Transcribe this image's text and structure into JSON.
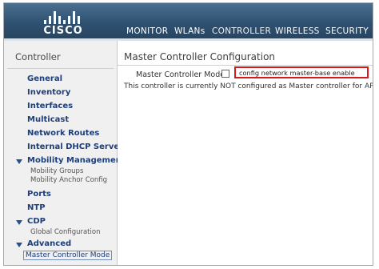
{
  "header": {
    "brand": "CISCO",
    "nav": [
      {
        "label": "MONITOR",
        "name": "nav-monitor"
      },
      {
        "label": "WLANs",
        "name": "nav-wlans"
      },
      {
        "label": "CONTROLLER",
        "name": "nav-controller"
      },
      {
        "label": "WIRELESS",
        "name": "nav-wireless"
      },
      {
        "label": "SECURITY",
        "name": "nav-security"
      }
    ]
  },
  "sidebar": {
    "title": "Controller",
    "items": [
      {
        "label": "General"
      },
      {
        "label": "Inventory"
      },
      {
        "label": "Interfaces"
      },
      {
        "label": "Multicast"
      },
      {
        "label": "Network Routes"
      },
      {
        "label": "Internal DHCP Server"
      },
      {
        "label": "Mobility Management"
      },
      {
        "label": "Ports"
      },
      {
        "label": "NTP"
      },
      {
        "label": "CDP"
      },
      {
        "label": "Advanced"
      }
    ],
    "subitems": {
      "mobility_groups": "Mobility Groups",
      "mobility_anchor": "Mobility Anchor Config",
      "global_config": "Global Configuration",
      "master_controller_mode": "Master Controller Mode"
    }
  },
  "main": {
    "title": "Master Controller Configuration",
    "master_mode_label": "Master Controller Mode",
    "master_mode_checked": false,
    "status_note": "This controller is currently NOT configured as Master controller for APs",
    "cli_command": "config network master-base enable"
  },
  "colors": {
    "header_bg": "#2e5070",
    "link": "#1d3e79",
    "callout_border": "#d7191c"
  }
}
